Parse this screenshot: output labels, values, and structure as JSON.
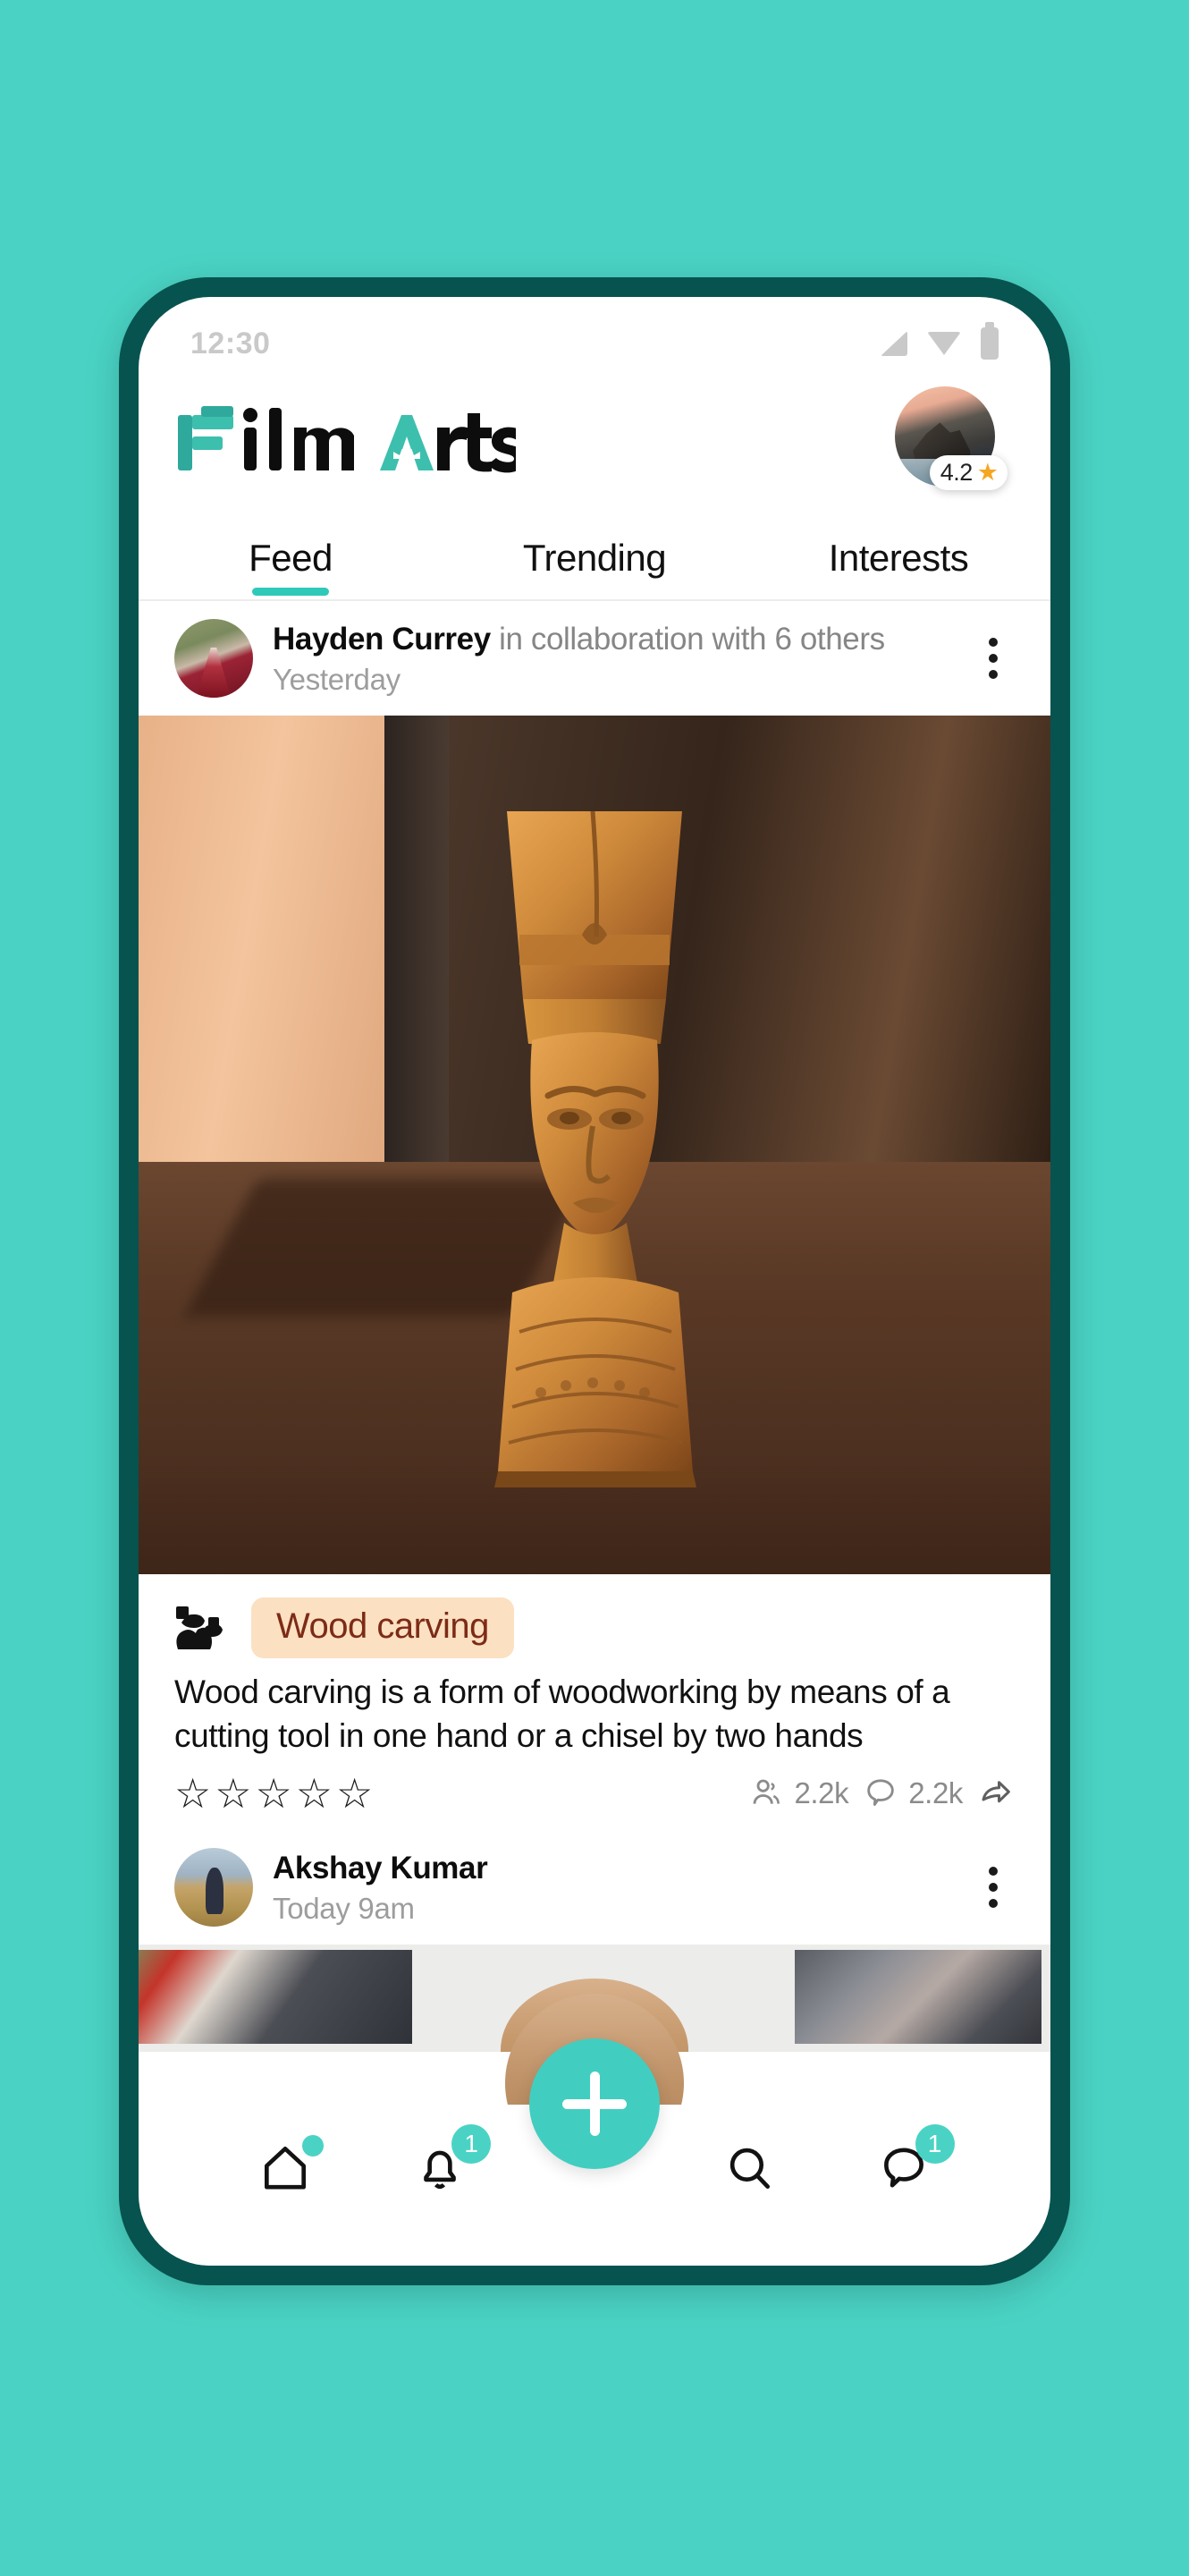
{
  "theme": {
    "background": "#4ad3c4",
    "frame": "#07534f",
    "accent": "#2fc9b8",
    "accent_light": "#4ad3c4",
    "tag_bg": "#fbe0c2",
    "tag_text": "#7d2b16",
    "star_gold": "#f5a623"
  },
  "status_bar": {
    "time": "12:30",
    "icons": [
      "signal-icon",
      "wifi-icon",
      "battery-icon"
    ]
  },
  "header": {
    "logo_text": "FilmArtsy",
    "logo_part1": "F",
    "logo_part2": "ilm",
    "logo_part3": "A",
    "logo_part4": "rtsy",
    "avatar_name": "profile-avatar",
    "rating": "4.2",
    "rating_icon": "star-icon"
  },
  "tabs": [
    {
      "label": "Feed",
      "active": true
    },
    {
      "label": "Trending",
      "active": false
    },
    {
      "label": "Interests",
      "active": false
    }
  ],
  "posts": [
    {
      "author": "Hayden Currey",
      "collab": " in collaboration with 6 others",
      "time": "Yesterday",
      "menu_icon": "kebab-menu-icon",
      "photo_alt": "wooden-nefertiti-bust-carving",
      "tag_icon": "hand-carving-icon",
      "tag": "Wood carving",
      "description": "Wood carving is a form of woodworking by means of a cutting tool in one hand or a chisel by two hands",
      "rating_stars": 5,
      "rating_filled": 0,
      "stats": [
        {
          "icon": "people-icon",
          "value": "2.2k"
        },
        {
          "icon": "comment-icon",
          "value": "2.2k"
        },
        {
          "icon": "share-icon",
          "value": ""
        }
      ]
    },
    {
      "author": "Akshay Kumar",
      "collab": "",
      "time": "Today 9am",
      "menu_icon": "kebab-menu-icon",
      "photo_alt": "art-gallery-paintings-preview"
    }
  ],
  "fab": {
    "icon": "plus-icon",
    "label": "Create post"
  },
  "bottom_nav": [
    {
      "name": "home",
      "icon": "home-icon",
      "badge": "",
      "dot": true
    },
    {
      "name": "notifications",
      "icon": "bell-icon",
      "badge": "1",
      "dot": false
    },
    {
      "name": "search",
      "icon": "search-icon",
      "badge": "",
      "dot": false
    },
    {
      "name": "messages",
      "icon": "chat-icon",
      "badge": "1",
      "dot": false
    }
  ]
}
